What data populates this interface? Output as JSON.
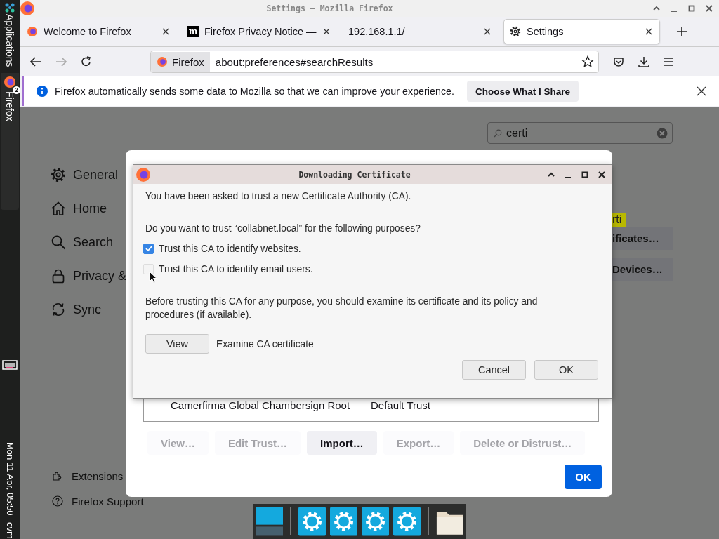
{
  "side_panel": {
    "applications_label": "Applications",
    "app_label": "Firefox",
    "app_badge": "2",
    "clock": "Mon 11 Apr, 05:50",
    "user": "cvm"
  },
  "window": {
    "title": "Settings — Mozilla Firefox"
  },
  "tabs": [
    {
      "title": "Welcome to Firefox",
      "kind": "browser",
      "selected": false
    },
    {
      "title": "Firefox Privacy Notice —",
      "kind": "letter",
      "icon_text": "m",
      "selected": false
    },
    {
      "title": "192.168.1.1/",
      "kind": "plain",
      "selected": false
    },
    {
      "title": "Settings",
      "kind": "settings",
      "selected": true
    }
  ],
  "address_bar": {
    "identity": "Firefox",
    "url": "about:preferences#searchResults"
  },
  "notification": {
    "message": "Firefox automatically sends some data to Mozilla so that we can improve your experience.",
    "button": "Choose What I Share"
  },
  "sidebar": {
    "items": [
      {
        "label": "General",
        "kind": "general"
      },
      {
        "label": "Home",
        "kind": "home"
      },
      {
        "label": "Search",
        "kind": "search"
      },
      {
        "label": "Privacy &",
        "kind": "privacy"
      },
      {
        "label": "Sync",
        "kind": "sync"
      }
    ],
    "footer": [
      {
        "label": "Extensions",
        "kind": "extensions"
      },
      {
        "label": "Firefox Support",
        "kind": "support"
      }
    ]
  },
  "search": {
    "value": "certi"
  },
  "results": [
    {
      "text": "rti",
      "kind": "highlight"
    },
    {
      "text": "ificates…",
      "kind": "button"
    },
    {
      "text": "Devices…",
      "kind": "button"
    }
  ],
  "certificate_manager": {
    "row": [
      "Camerfirma Global Chambersign Root",
      "Default Trust"
    ],
    "buttons": [
      {
        "label": "View…",
        "disabled": true
      },
      {
        "label": "Edit Trust…",
        "disabled": true
      },
      {
        "label": "Import…",
        "disabled": false
      },
      {
        "label": "Export…",
        "disabled": true
      },
      {
        "label": "Delete or Distrust…",
        "disabled": true
      }
    ],
    "ok": "OK"
  },
  "download_dialog": {
    "title": "Downloading Certificate",
    "intro": "You have been asked to trust a new Certificate Authority (CA).",
    "question": "Do you want to trust “collabnet.local” for the following purposes?",
    "options": [
      {
        "label": "Trust this CA to identify websites.",
        "checked": true
      },
      {
        "label": "Trust this CA to identify email users.",
        "checked": false
      }
    ],
    "note": "Before trusting this CA for any purpose, you should examine its certificate and its policy and procedures (if available).",
    "view_button": "View",
    "view_label": "Examine CA certificate",
    "buttons": [
      "Cancel",
      "OK"
    ]
  },
  "dock": [
    {
      "kind": "desktop"
    },
    {
      "kind": "settings"
    },
    {
      "kind": "settings"
    },
    {
      "kind": "settings"
    },
    {
      "kind": "settings"
    },
    {
      "kind": "folder"
    }
  ]
}
